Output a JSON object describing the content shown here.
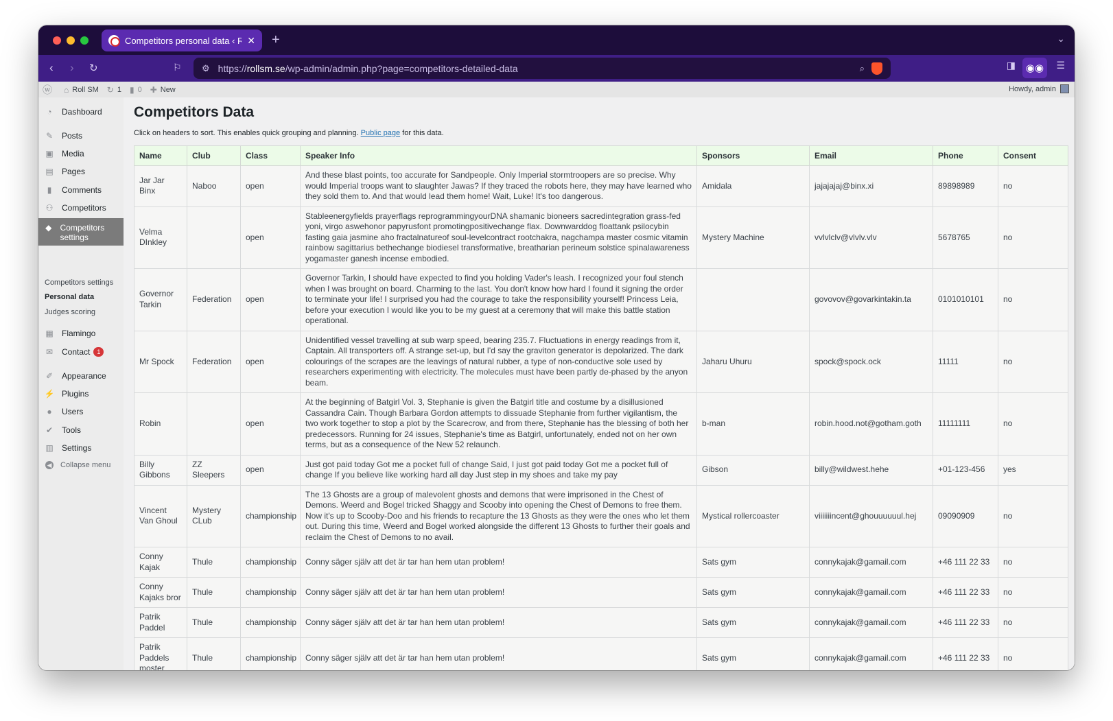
{
  "browser": {
    "tab_title": "Competitors personal data ‹ R",
    "tab_close": "✕",
    "new_tab": "+",
    "tab_menu": "⌄",
    "url_prefix": "https://",
    "url_domain": "rollsm.se",
    "url_path": "/wp-admin/admin.php?page=competitors-detailed-data"
  },
  "adminbar": {
    "site_name": "Roll SM",
    "updates_count": "1",
    "comments_count": "0",
    "new_label": "New",
    "howdy": "Howdy, admin"
  },
  "sidebar": {
    "dashboard": "Dashboard",
    "posts": "Posts",
    "media": "Media",
    "pages": "Pages",
    "comments": "Comments",
    "competitors": "Competitors",
    "competitors_settings": "Competitors settings",
    "sub_competitors_settings": "Competitors settings",
    "sub_personal_data": "Personal data",
    "sub_judges_scoring": "Judges scoring",
    "flamingo": "Flamingo",
    "contact": "Contact",
    "contact_badge": "1",
    "appearance": "Appearance",
    "plugins": "Plugins",
    "users": "Users",
    "tools": "Tools",
    "settings": "Settings",
    "collapse": "Collapse menu"
  },
  "page": {
    "title": "Competitors Data",
    "intro_before": "Click on headers to sort. This enables quick grouping and planning. ",
    "intro_link": "Public page",
    "intro_after": " for this data."
  },
  "table": {
    "headers": [
      "Name",
      "Club",
      "Class",
      "Speaker Info",
      "Sponsors",
      "Email",
      "Phone",
      "Consent"
    ],
    "rows": [
      [
        "Jar Jar Binx",
        "Naboo",
        "open",
        "And these blast points, too accurate for Sandpeople. Only Imperial stormtroopers are so precise. Why would Imperial troops want to slaughter Jawas? If they traced the robots here, they may have learned who they sold them to. And that would lead them home! Wait, Luke! It's too dangerous.",
        "Amidala",
        "jajajajaj@binx.xi",
        "89898989",
        "no"
      ],
      [
        "Velma DInkley",
        "",
        "open",
        "Stableenergyfields prayerflags reprogrammingyourDNA shamanic bioneers sacredintegration grass-fed yoni, virgo aswehonor papyrusfont promotingpositivechange flax. Downwarddog floattank psilocybin fasting gaia jasmine aho fractalnatureof soul-levelcontract rootchakra, nagchampa master cosmic vitamin rainbow sagittarius bethechange biodiesel transformative, breatharian perineum solstice spinalawareness yogamaster ganesh incense embodied.",
        "Mystery Machine",
        "vvlvlclv@vlvlv.vlv",
        "5678765",
        "no"
      ],
      [
        "Governor Tarkin",
        "Federation",
        "open",
        "Governor Tarkin, I should have expected to find you holding Vader's leash. I recognized your foul stench when I was brought on board. Charming to the last. You don't know how hard I found it signing the order to terminate your life! I surprised you had the courage to take the responsibility yourself! Princess Leia, before your execution I would like you to be my guest at a ceremony that will make this battle station operational.",
        "",
        "govovov@govarkintakin.ta",
        "0101010101",
        "no"
      ],
      [
        "Mr Spock",
        "Federation",
        "open",
        "Unidentified vessel travelling at sub warp speed, bearing 235.7. Fluctuations in energy readings from it, Captain. All transporters off. A strange set-up, but I'd say the graviton generator is depolarized. The dark colourings of the scrapes are the leavings of natural rubber, a type of non-conductive sole used by researchers experimenting with electricity. The molecules must have been partly de-phased by the anyon beam.",
        "Jaharu Uhuru",
        "spock@spock.ock",
        "11111",
        "no"
      ],
      [
        "Robin",
        "",
        "open",
        "At the beginning of Batgirl Vol. 3, Stephanie is given the Batgirl title and costume by a disillusioned Cassandra Cain. Though Barbara Gordon attempts to dissuade Stephanie from further vigilantism, the two work together to stop a plot by the Scarecrow, and from there, Stephanie has the blessing of both her predecessors. Running for 24 issues, Stephanie's time as Batgirl, unfortunately, ended not on her own terms, but as a consequence of the New 52 relaunch.",
        "b-man",
        "robin.hood.not@gotham.goth",
        "11111111",
        "no"
      ],
      [
        "Billy Gibbons",
        "ZZ Sleepers",
        "open",
        "Just got paid today Got me a pocket full of change Said, I just got paid today Got me a pocket full of change If you believe like working hard all day Just step in my shoes and take my pay",
        "Gibson",
        "billy@wildwest.hehe",
        "+01-123-456",
        "yes"
      ],
      [
        "Vincent Van Ghoul",
        "Mystery CLub",
        "championship",
        "The 13 Ghosts are a group of malevolent ghosts and demons that were imprisoned in the Chest of Demons. Weerd and Bogel tricked Shaggy and Scooby into opening the Chest of Demons to free them. Now it's up to Scooby-Doo and his friends to recapture the 13 Ghosts as they were the ones who let them out. During this time, Weerd and Bogel worked alongside the different 13 Ghosts to further their goals and reclaim the Chest of Demons to no avail.",
        "Mystical rollercoaster",
        "viiiiiiincent@ghouuuuuul.hej",
        "09090909",
        "no"
      ],
      [
        "Conny Kajak",
        "Thule",
        "championship",
        "Conny säger själv att det är tar han hem utan problem!",
        "Sats gym",
        "connykajak@gamail.com",
        "+46 111 22 33",
        "no"
      ],
      [
        "Conny Kajaks bror",
        "Thule",
        "championship",
        "Conny säger själv att det är tar han hem utan problem!",
        "Sats gym",
        "connykajak@gamail.com",
        "+46 111 22 33",
        "no"
      ],
      [
        "Patrik Paddel",
        "Thule",
        "championship",
        "Conny säger själv att det är tar han hem utan problem!",
        "Sats gym",
        "connykajak@gamail.com",
        "+46 111 22 33",
        "no"
      ],
      [
        "Patrik Paddels moster",
        "Thule",
        "championship",
        "Conny säger själv att det är tar han hem utan problem!",
        "Sats gym",
        "connykajak@gamail.com",
        "+46 111 22 33",
        "no"
      ]
    ]
  },
  "colors": {
    "tab_strip": "#1d0d3b",
    "toolbar": "#3f1e86",
    "active_tab": "#5b2bb0",
    "header_row": "#ecfbe8",
    "link": "#2271b1",
    "badge": "#d63638"
  }
}
